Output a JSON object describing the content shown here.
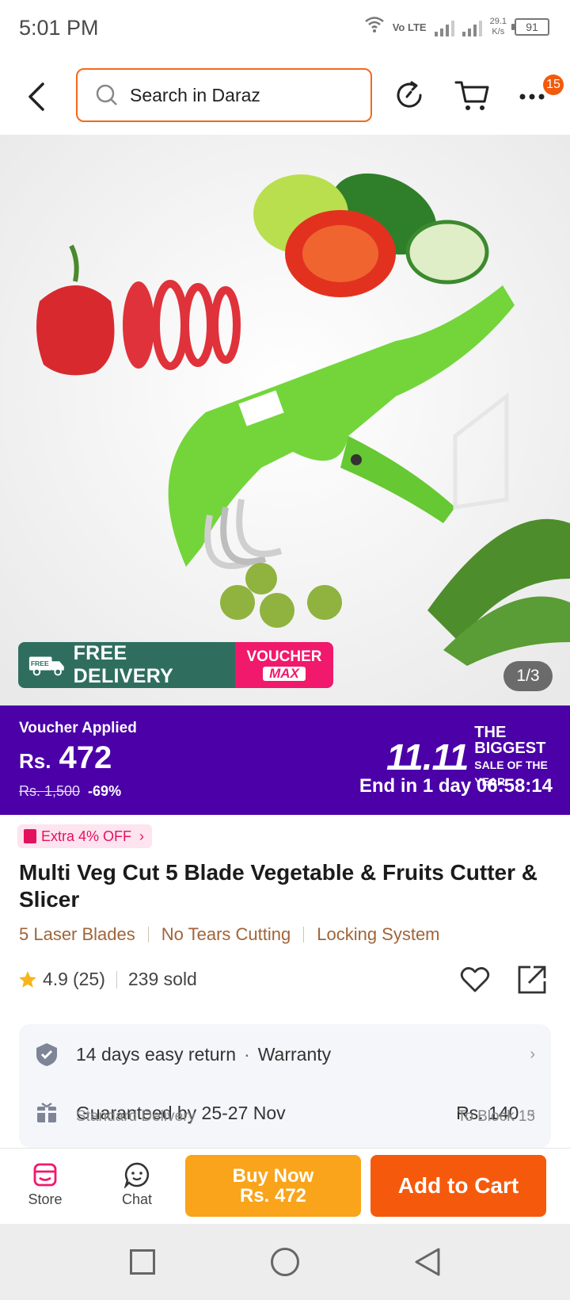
{
  "status_bar": {
    "time": "5:01 PM",
    "network": "Vo LTE",
    "speed_value": "29.1",
    "speed_unit": "K/s",
    "battery": "91"
  },
  "header": {
    "search_placeholder": "Search in Daraz",
    "notification_count": "15"
  },
  "gallery": {
    "counter": "1/3",
    "promo_free_label": "FREE DELIVERY",
    "promo_truck_label": "FREE",
    "promo_voucher_line1": "VOUCHER",
    "promo_voucher_line2": "MAX"
  },
  "price_bar": {
    "voucher_applied": "Voucher Applied",
    "currency": "Rs.",
    "price": "472",
    "original_price": "Rs. 1,500",
    "discount": "-69%",
    "sale_number": "11.11",
    "sale_line1": "THE BIGGEST",
    "sale_line2": "SALE OF THE YEAR",
    "countdown": "End in 1 day 06:58:14",
    "colors": {
      "background": "#4b00a8"
    }
  },
  "product": {
    "extra_off": "Extra 4% OFF",
    "title": "Multi Veg Cut 5 Blade Vegetable & Fruits Cutter & Slicer",
    "features": [
      "5 Laser Blades",
      "No Tears Cutting",
      "Locking System"
    ],
    "rating": "4.9",
    "reviews": "(25)",
    "sold": "239 sold"
  },
  "service_card": {
    "return_text": "14 days easy return",
    "warranty_text": "Warranty",
    "delivery_text": "Guaranteed by 25-27 Nov",
    "delivery_price": "Rs. 140",
    "delivery_sub": "Standard Delivery",
    "delivery_location": "To Block 15"
  },
  "action_bar": {
    "store_label": "Store",
    "chat_label": "Chat",
    "buy_now_line1": "Buy Now",
    "buy_now_line2": "Rs. 472",
    "add_to_cart": "Add to Cart",
    "colors": {
      "buy_now": "#f9a41a",
      "add_to_cart": "#f55a0c"
    }
  }
}
